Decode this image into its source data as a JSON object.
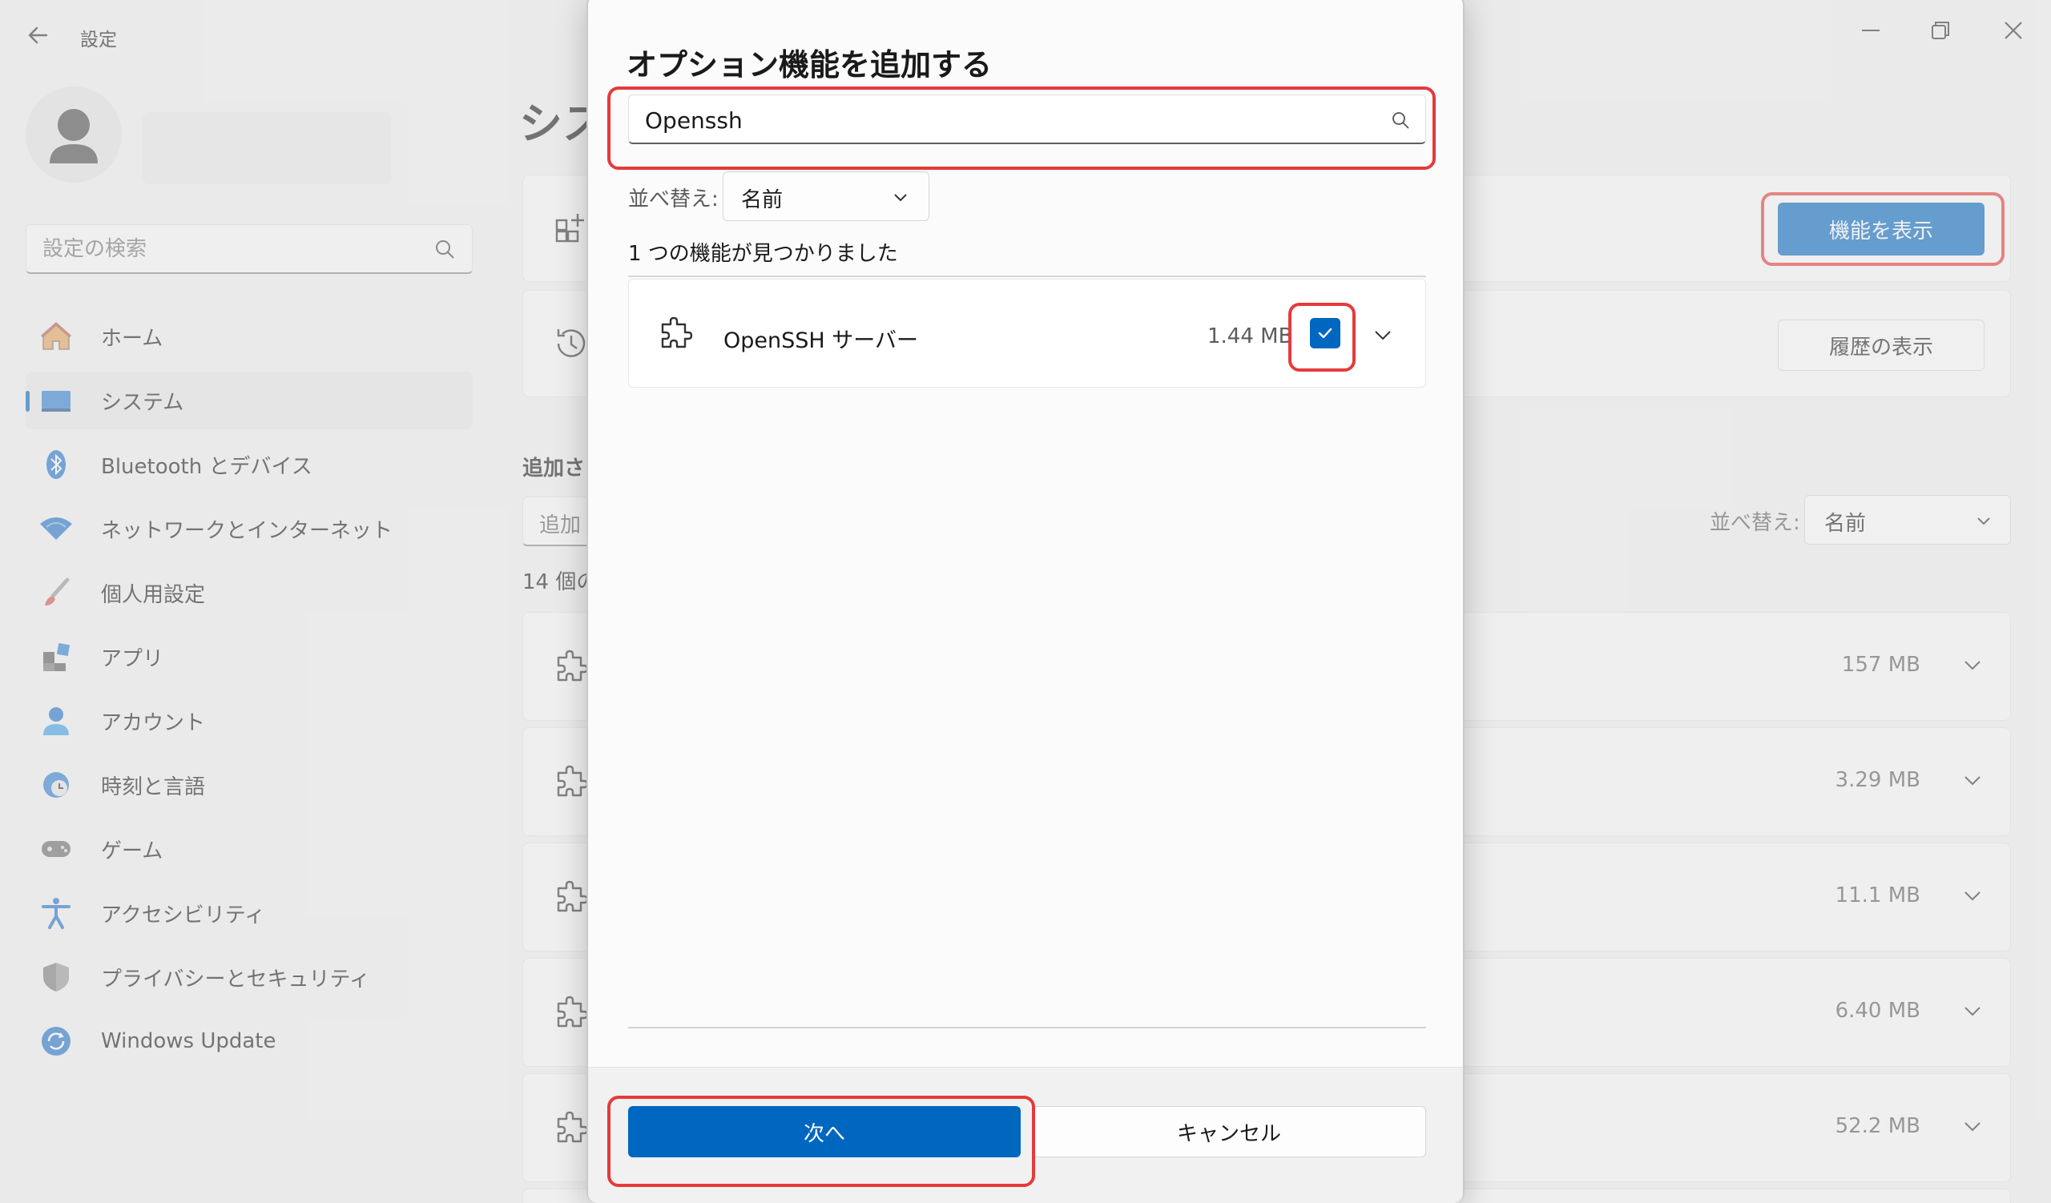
{
  "window": {
    "app_title": "設定"
  },
  "sidebar": {
    "search_placeholder": "設定の検索",
    "items": [
      {
        "label": "ホーム",
        "icon": "home-icon"
      },
      {
        "label": "システム",
        "icon": "system-icon",
        "active": true
      },
      {
        "label": "Bluetooth とデバイス",
        "icon": "bluetooth-icon"
      },
      {
        "label": "ネットワークとインターネット",
        "icon": "wifi-icon"
      },
      {
        "label": "個人用設定",
        "icon": "paintbrush-icon"
      },
      {
        "label": "アプリ",
        "icon": "apps-icon"
      },
      {
        "label": "アカウント",
        "icon": "account-icon"
      },
      {
        "label": "時刻と言語",
        "icon": "time-language-icon"
      },
      {
        "label": "ゲーム",
        "icon": "gamepad-icon"
      },
      {
        "label": "アクセシビリティ",
        "icon": "accessibility-icon"
      },
      {
        "label": "プライバシーとセキュリティ",
        "icon": "shield-icon"
      },
      {
        "label": "Windows Update",
        "icon": "update-icon"
      }
    ]
  },
  "main": {
    "heading": "シス",
    "show_features_label": "機能を表示",
    "show_history_label": "履歴の表示",
    "section_title": "追加さ",
    "filter_placeholder": "追加",
    "count_label": "14 個の",
    "sort_label": "並べ替え:",
    "sort_value": "名前",
    "feature_sizes": [
      "157 MB",
      "3.29 MB",
      "11.1 MB",
      "6.40 MB",
      "52.2 MB"
    ]
  },
  "dialog": {
    "title": "オプション機能を追加する",
    "search_value": "Openssh",
    "sort_label": "並べ替え:",
    "sort_value": "名前",
    "found_text": "1 つの機能が見つかりました",
    "results": [
      {
        "name": "OpenSSH サーバー",
        "size": "1.44 MB",
        "checked": true
      }
    ],
    "next_label": "次へ",
    "cancel_label": "キャンセル"
  },
  "colors": {
    "accent": "#0067c0",
    "highlight": "#e53a3a"
  }
}
